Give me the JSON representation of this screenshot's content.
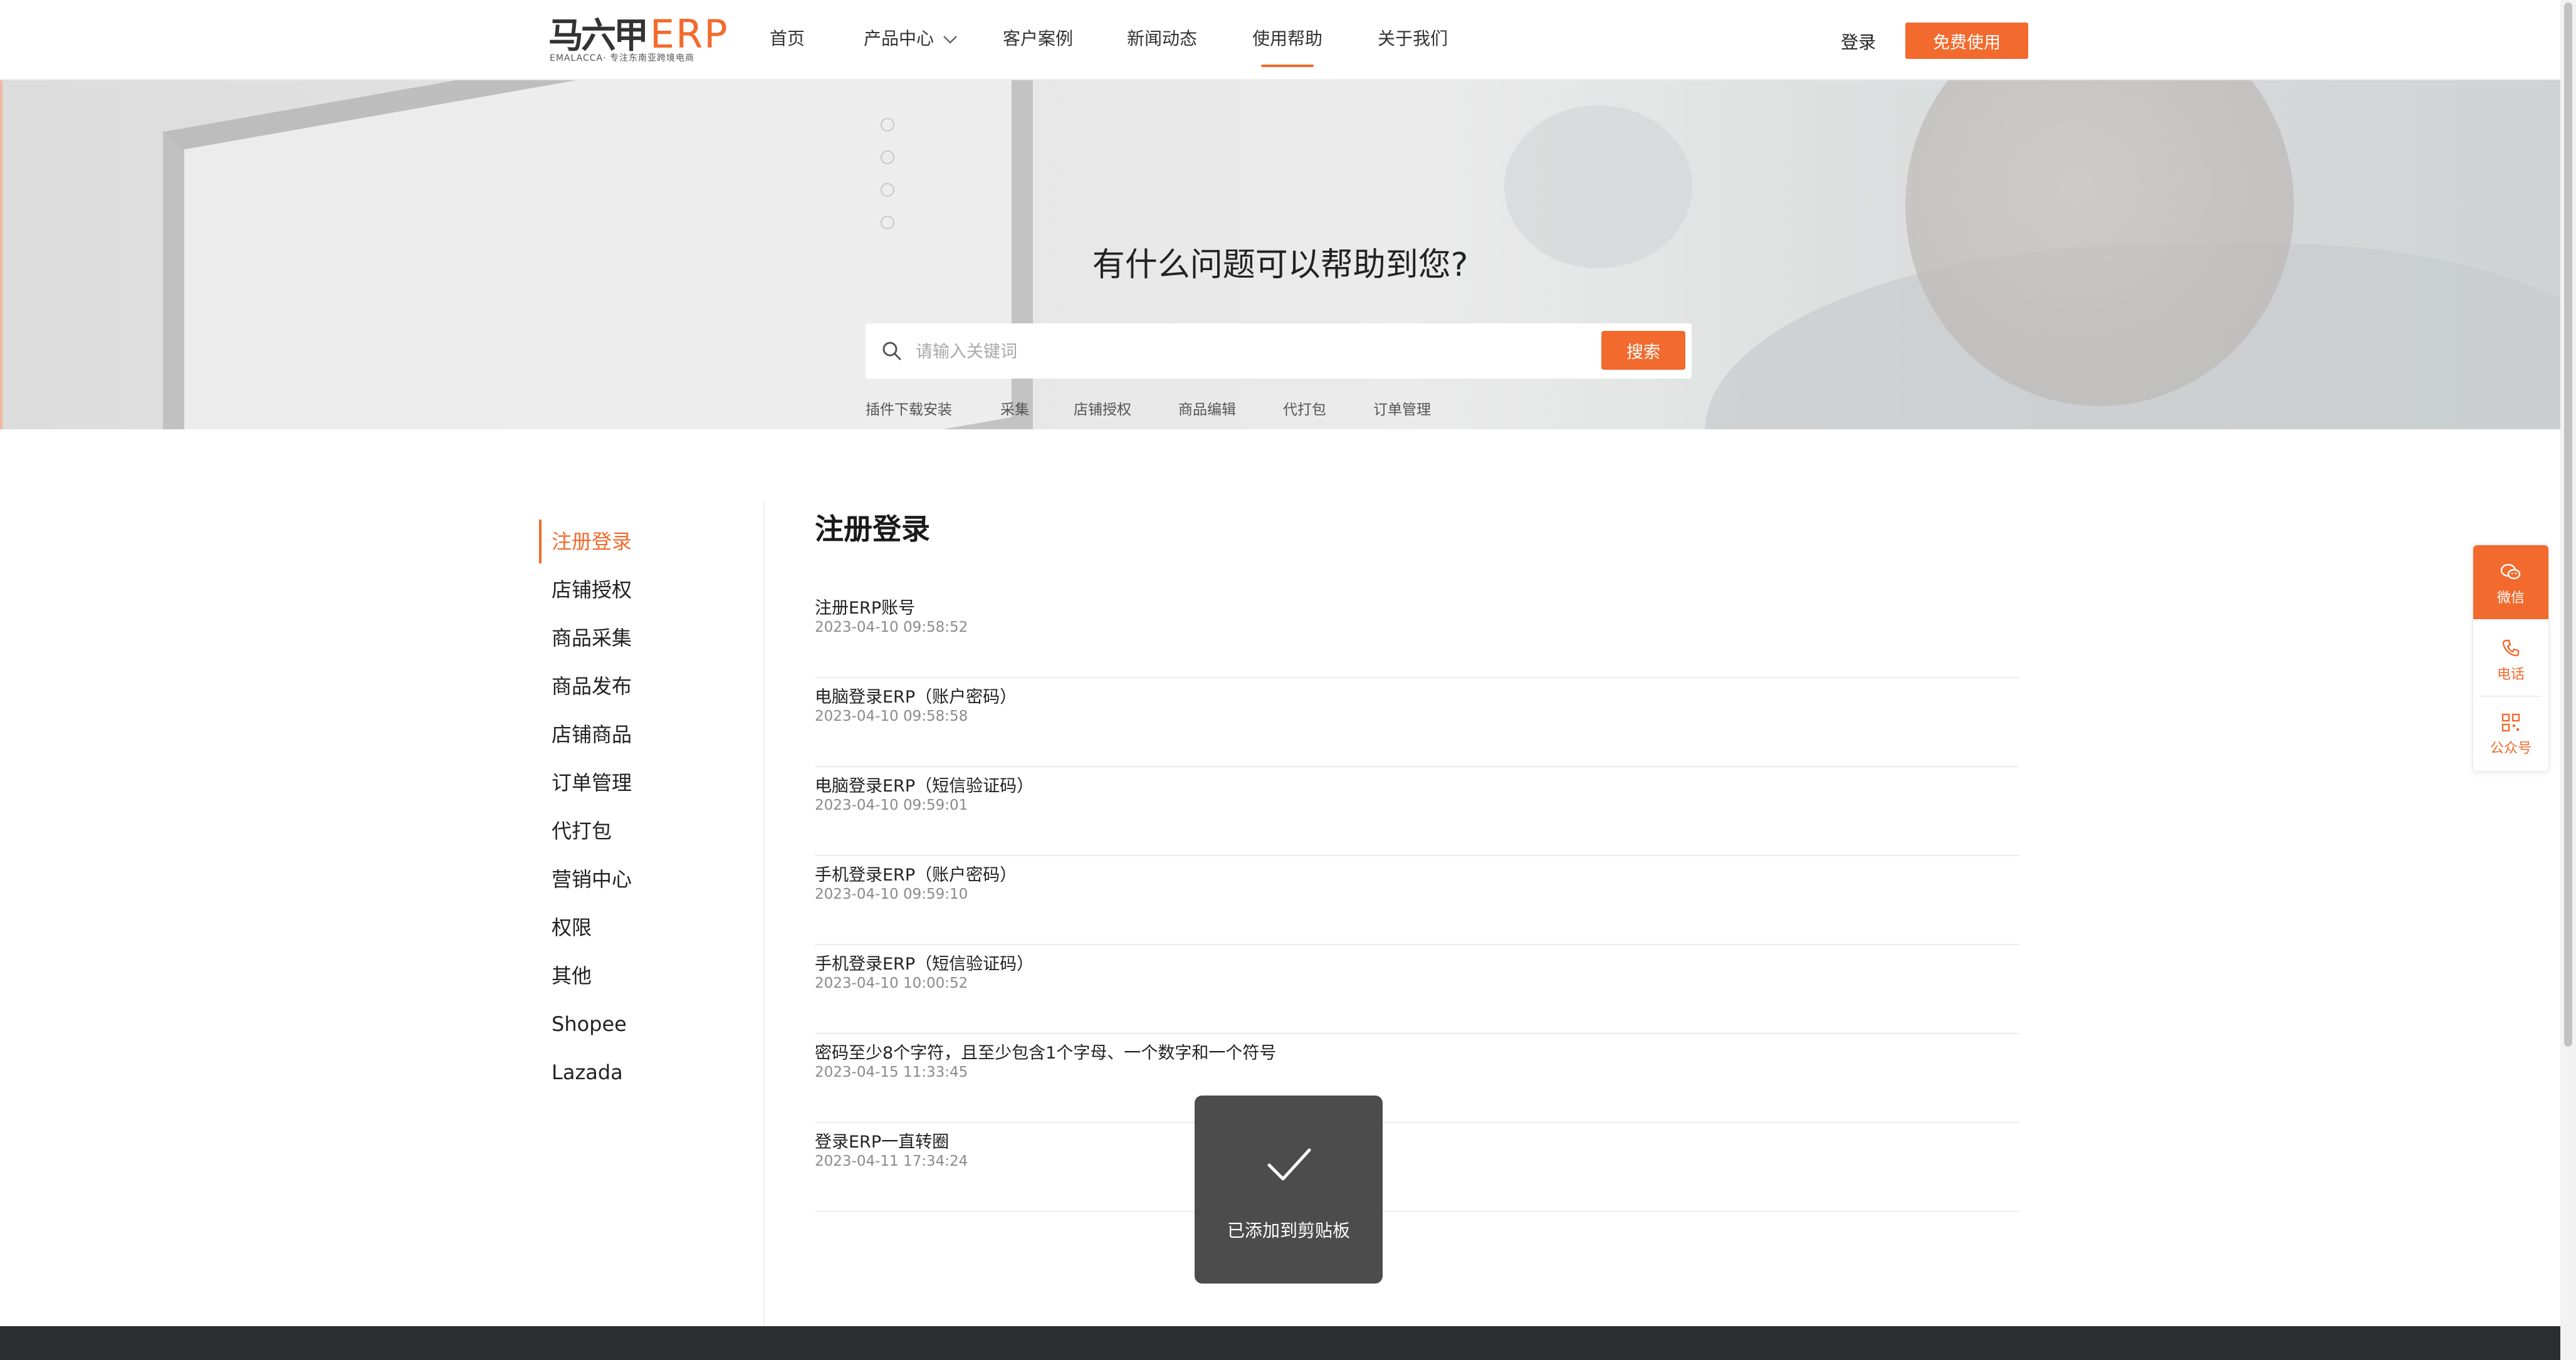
{
  "brand": {
    "logo_cn": "马六甲",
    "logo_erp": "ERP",
    "logo_sub": "EMALACCA· 专注东南亚跨境电商",
    "accent_color": "#f26a2d"
  },
  "nav": {
    "items": [
      {
        "label": "首页"
      },
      {
        "label": "产品中心"
      },
      {
        "label": "客户案例"
      },
      {
        "label": "新闻动态"
      },
      {
        "label": "使用帮助",
        "active": true
      },
      {
        "label": "关于我们"
      }
    ],
    "login_label": "登录",
    "free_label": "免费使用"
  },
  "hero": {
    "title": "有什么问题可以帮助到您?",
    "search_placeholder": "请输入关键词",
    "search_button": "搜索",
    "hot_tags": [
      "插件下载安装",
      "采集",
      "店铺授权",
      "商品编辑",
      "代打包",
      "订单管理"
    ]
  },
  "sidebar": {
    "items": [
      {
        "label": "注册登录",
        "active": true
      },
      {
        "label": "店铺授权"
      },
      {
        "label": "商品采集"
      },
      {
        "label": "商品发布"
      },
      {
        "label": "店铺商品"
      },
      {
        "label": "订单管理"
      },
      {
        "label": "代打包"
      },
      {
        "label": "营销中心"
      },
      {
        "label": "权限"
      },
      {
        "label": "其他"
      },
      {
        "label": "Shopee"
      },
      {
        "label": "Lazada"
      }
    ]
  },
  "main": {
    "section_title": "注册登录",
    "articles": [
      {
        "title": "注册ERP账号",
        "date": "2023-04-10 09:58:52"
      },
      {
        "title": "电脑登录ERP（账户密码）",
        "date": "2023-04-10 09:58:58"
      },
      {
        "title": "电脑登录ERP（短信验证码）",
        "date": "2023-04-10 09:59:01"
      },
      {
        "title": "手机登录ERP（账户密码）",
        "date": "2023-04-10 09:59:10"
      },
      {
        "title": "手机登录ERP（短信验证码）",
        "date": "2023-04-10 10:00:52"
      },
      {
        "title": "密码至少8个字符，且至少包含1个字母、一个数字和一个符号",
        "date": "2023-04-15 11:33:45"
      },
      {
        "title": "登录ERP一直转圈",
        "date": "2023-04-11 17:34:24"
      }
    ]
  },
  "float_contact": {
    "items": [
      {
        "label": "微信",
        "icon": "wechat-icon"
      },
      {
        "label": "电话",
        "icon": "phone-icon"
      },
      {
        "label": "公众号",
        "icon": "qrcode-icon"
      }
    ]
  },
  "toast": {
    "message": "已添加到剪贴板",
    "icon": "check-icon"
  }
}
